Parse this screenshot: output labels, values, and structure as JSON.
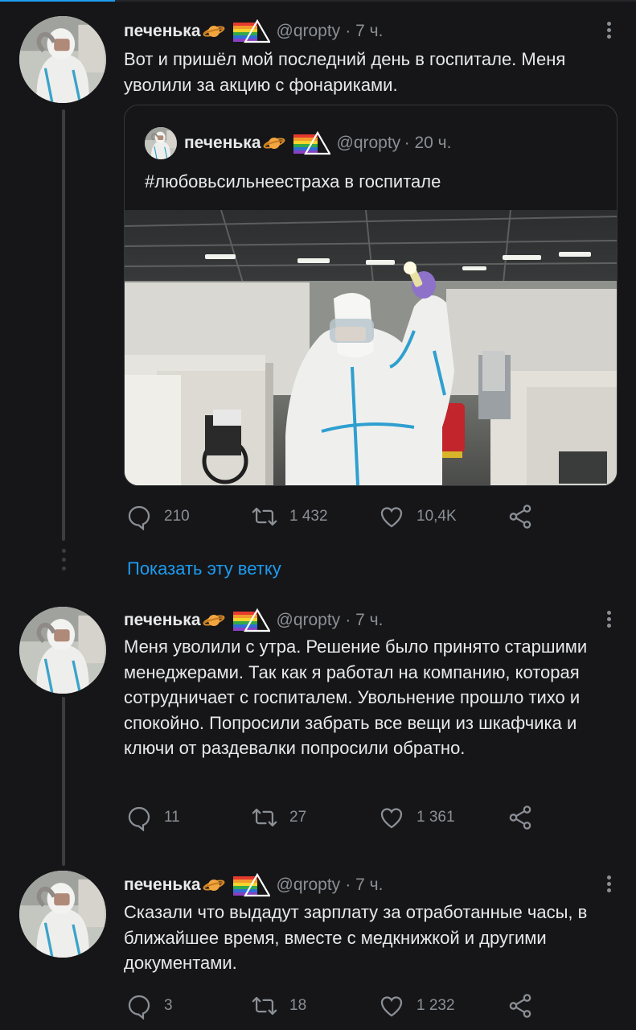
{
  "colors": {
    "background": "#161618",
    "accent": "#1d9bf0",
    "muted": "#8b8f96",
    "text": "#e7e9ea"
  },
  "tweets": [
    {
      "name": "печенька",
      "handle": "@qropty",
      "time": "· 7 ч.",
      "text": "Вот и пришёл мой последний день в госпитале. Меня уволили за акцию с фонариками.",
      "quote": {
        "name": "печенька",
        "handle": "@qropty",
        "time": "· 20 ч.",
        "text": "#любовьсильнеестраха в госпитале",
        "media_alt": "person-in-protective-suit-holding-flashlight-photo"
      },
      "replies": "210",
      "retweets": "1 432",
      "likes": "10,4K"
    },
    {
      "name": "печенька",
      "handle": "@qropty",
      "time": "· 7 ч.",
      "text": "Меня уволили с утра. Решение было принято старшими менеджерами. Так как я работал на компанию, которая сотрудничает с госпиталем. Увольнение прошло тихо и спокойно. Попросили забрать все вещи из шкафчика и ключи от раздевалки попросили обратно.",
      "replies": "11",
      "retweets": "27",
      "likes": "1 361"
    },
    {
      "name": "печенька",
      "handle": "@qropty",
      "time": "· 7 ч.",
      "text": "Сказали что выдадут зарплату за отработанные часы, в ближайшее время, вместе с медкнижкой и другими документами.",
      "replies": "3",
      "retweets": "18",
      "likes": "1 232"
    }
  ],
  "show_thread_label": "Показать эту ветку",
  "icons": [
    "reply-icon",
    "retweet-icon",
    "like-icon",
    "share-icon",
    "more-icon",
    "planet-emoji-icon",
    "rainbow-triangle-flag-icon"
  ]
}
